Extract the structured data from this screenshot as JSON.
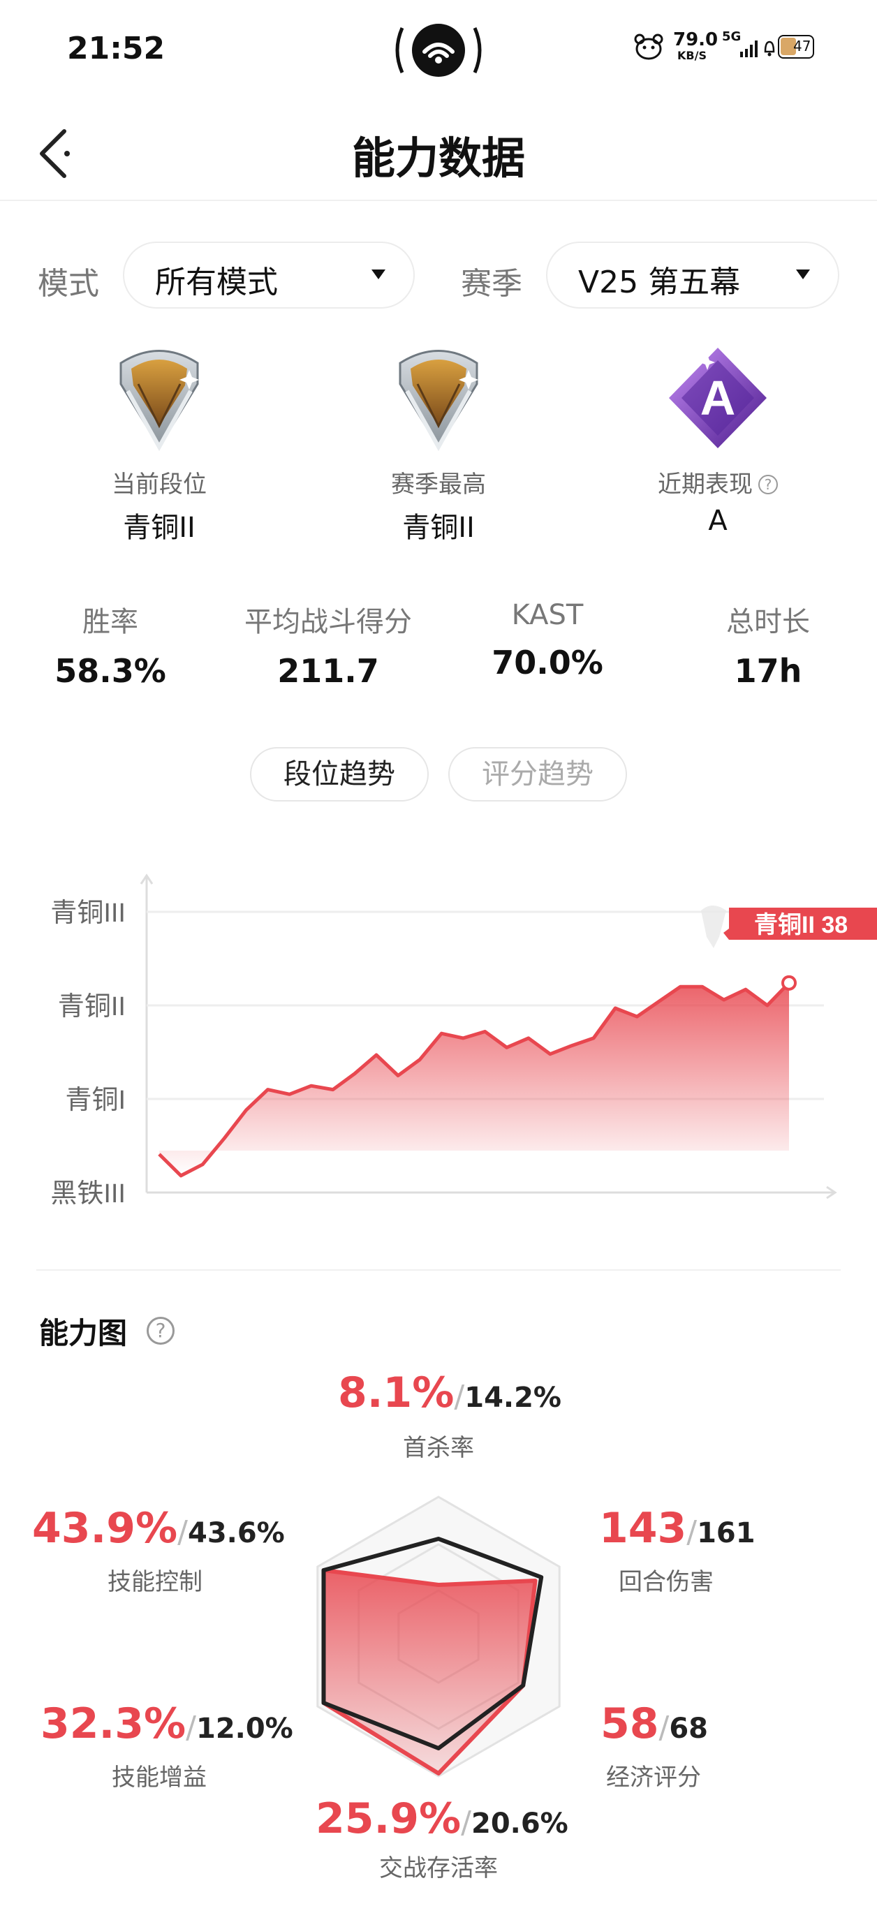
{
  "status": {
    "time": "21:52",
    "speed_value": "79.0",
    "speed_unit": "KB/S",
    "network": "5G",
    "battery": "47"
  },
  "nav": {
    "title": "能力数据"
  },
  "filters": {
    "mode_label": "模式",
    "mode_value": "所有模式",
    "season_label": "赛季",
    "season_value": "V25 第五幕"
  },
  "ranks": [
    {
      "label": "当前段位",
      "value": "青铜II"
    },
    {
      "label": "赛季最高",
      "value": "青铜II"
    },
    {
      "label": "近期表现",
      "value": "A",
      "badge_letter": "A"
    }
  ],
  "stats": [
    {
      "label": "胜率",
      "value": "58.3%"
    },
    {
      "label": "平均战斗得分",
      "value": "211.7"
    },
    {
      "label": "KAST",
      "value": "70.0%"
    },
    {
      "label": "总时长",
      "value": "17h"
    }
  ],
  "tabs": {
    "active": "段位趋势",
    "inactive": "评分趋势"
  },
  "chart_data": {
    "type": "area",
    "title": "",
    "xlabel": "",
    "ylabel": "",
    "y_tick_labels": [
      "黑铁III",
      "青铜I",
      "青铜II",
      "青铜III"
    ],
    "ylim": [
      0,
      3
    ],
    "grid": true,
    "series": [
      {
        "values": [
          0.41,
          0.18,
          0.3,
          0.58,
          0.88,
          1.1,
          1.05,
          1.14,
          1.1,
          1.27,
          1.47,
          1.25,
          1.42,
          1.7,
          1.65,
          1.72,
          1.55,
          1.65,
          1.48,
          1.57,
          1.65,
          1.97,
          1.88,
          2.04,
          2.2,
          2.2,
          2.06,
          2.17,
          2.0,
          2.24
        ]
      }
    ],
    "current_tag": "青铜II 38",
    "color": "#e8474f"
  },
  "radar": {
    "title": "能力图",
    "help": "?",
    "metrics": [
      {
        "label": "首杀率",
        "value": "8.1%",
        "avg": "14.2%",
        "self_level": 0.37,
        "avg_level": 0.7
      },
      {
        "label": "回合伤害",
        "value": "143",
        "avg": "161",
        "self_level": 0.8,
        "avg_level": 0.85
      },
      {
        "label": "经济评分",
        "value": "58",
        "avg": "68",
        "self_level": 0.7,
        "avg_level": 0.7
      },
      {
        "label": "交战存活率",
        "value": "25.9%",
        "avg": "20.6%",
        "self_level": 0.98,
        "avg_level": 0.8
      },
      {
        "label": "技能增益",
        "value": "32.3%",
        "avg": "12.0%",
        "self_level": 0.95,
        "avg_level": 0.95
      },
      {
        "label": "技能控制",
        "value": "43.9%",
        "avg": "43.6%",
        "self_level": 0.95,
        "avg_level": 0.95
      }
    ],
    "sep": "/",
    "self_color": "#e8474f",
    "avg_color": "#222222"
  }
}
